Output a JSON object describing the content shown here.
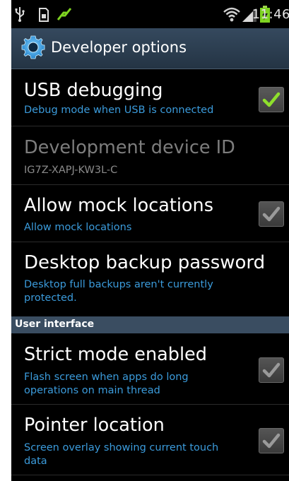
{
  "status_bar": {
    "time": "11:46",
    "icons": [
      "usb-icon",
      "sd-card-icon",
      "sync-icon",
      "wifi-icon",
      "signal-icon",
      "battery-charging-icon"
    ]
  },
  "header": {
    "title": "Developer options",
    "icon": "gear-icon"
  },
  "settings": [
    {
      "title": "USB debugging",
      "subtitle": "Debug mode when USB is connected",
      "checked": true,
      "enabled": true
    },
    {
      "title": "Development device ID",
      "subtitle": "IG7Z-XAPJ-KW3L-C",
      "enabled": false
    },
    {
      "title": "Allow mock locations",
      "subtitle": "Allow mock locations",
      "checked": true,
      "enabled": true
    },
    {
      "title": "Desktop backup password",
      "subtitle": "Desktop full backups aren't currently protected.",
      "enabled": true
    }
  ],
  "sections": [
    {
      "header": "User interface",
      "items": [
        {
          "title": "Strict mode enabled",
          "subtitle": "Flash screen when apps do long operations on main thread",
          "checked": true
        },
        {
          "title": "Pointer location",
          "subtitle": "Screen overlay showing current touch data",
          "checked": true
        }
      ]
    }
  ],
  "colors": {
    "background": "#000000",
    "accent": "#3b9bdb",
    "title_bar": "#2d3f52",
    "section_header": "#3a4d61",
    "check_active": "#7ed321"
  }
}
